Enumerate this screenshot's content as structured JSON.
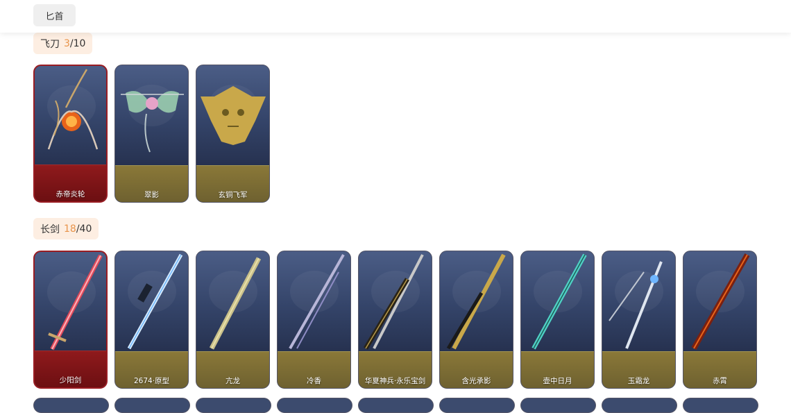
{
  "top_tab": {
    "label": "匕首"
  },
  "sections": [
    {
      "title": "飞刀",
      "owned": "3",
      "sep": "/",
      "total": "10",
      "items": [
        {
          "name": "赤帝炎轮",
          "selected": true,
          "icon": "flame-wheel-icon"
        },
        {
          "name": "翠影",
          "selected": false,
          "icon": "jade-butterfly-icon"
        },
        {
          "name": "玄铜飞军",
          "selected": false,
          "icon": "bronze-mask-icon"
        }
      ]
    },
    {
      "title": "长剑",
      "owned": "18",
      "sep": "/",
      "total": "40",
      "items": [
        {
          "name": "少阳剑",
          "selected": true,
          "icon": "red-sword-icon"
        },
        {
          "name": "2674·原型",
          "selected": false,
          "icon": "light-blade-icon"
        },
        {
          "name": "亢龙",
          "selected": false,
          "icon": "bamboo-sword-icon"
        },
        {
          "name": "冷香",
          "selected": false,
          "icon": "silver-sword-icon"
        },
        {
          "name": "华夏神兵·永乐宝剑",
          "selected": false,
          "icon": "ornate-sword-icon"
        },
        {
          "name": "含光承影",
          "selected": false,
          "icon": "gold-sword-icon"
        },
        {
          "name": "壶中日月",
          "selected": false,
          "icon": "teal-sword-icon"
        },
        {
          "name": "玉霜龙",
          "selected": false,
          "icon": "frost-sword-icon"
        },
        {
          "name": "赤霄",
          "selected": false,
          "icon": "crimson-sword-icon"
        }
      ]
    }
  ],
  "colors": {
    "accent_count": "#e8944a",
    "selected_border": "#9a1c22",
    "selected_footer": "#8f1a1c",
    "normal_footer": "#8a7838",
    "header_bg": "#fdeee2"
  }
}
